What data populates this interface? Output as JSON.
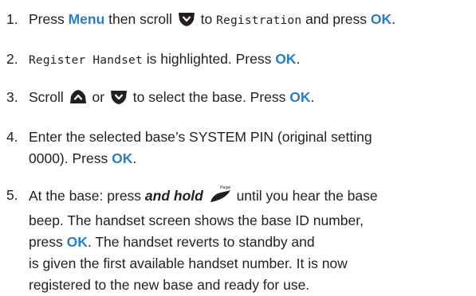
{
  "steps": [
    {
      "number": "1.",
      "t1": "Press ",
      "menu": "Menu",
      "t2": " then scroll ",
      "t3": " to ",
      "lcd_registration": "Registration",
      "t4": " and press ",
      "ok": "OK",
      "t5": ".",
      "icons": [
        "scroll-down-icon"
      ]
    },
    {
      "number": "2.",
      "lcd_register_handset": "Register Handset",
      "t1": " is highlighted. Press ",
      "ok": "OK",
      "t2": ".",
      "icons": []
    },
    {
      "number": "3.",
      "t1": "Scroll ",
      "t2": " or ",
      "t3": " to select the base. Press ",
      "ok": "OK",
      "t4": ".",
      "icons": [
        "scroll-up-icon",
        "scroll-down-icon"
      ]
    },
    {
      "number": "4.",
      "t1": "Enter the selected base’s SYSTEM PIN (original setting",
      "t2": "0000). Press ",
      "ok": "OK",
      "t3": ".",
      "icons": []
    },
    {
      "number": "5.",
      "t1": "At the base: press ",
      "and_hold": "and hold",
      "page_key_label": "Page",
      "t2": " until you hear the base",
      "line2": "beep. The handset screen shows the base ID number,",
      "line3_a": "press ",
      "ok": "OK",
      "line3_b": ". The handset reverts to standby and",
      "line4": "is given the first available handset number. It is now",
      "line5": "registered to the new base and ready for use.",
      "icons": [
        "page-key-icon"
      ]
    }
  ],
  "colors": {
    "keyword": "#2a7ec2",
    "text": "#231f20"
  }
}
